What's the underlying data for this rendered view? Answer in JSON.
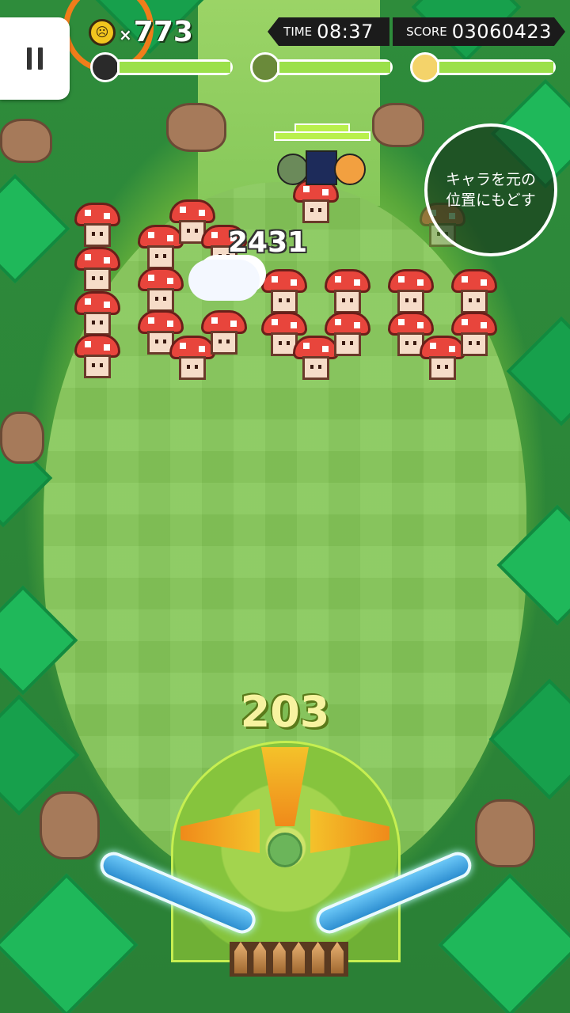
{
  "hud": {
    "coin_icon": "angry-coin-icon",
    "coin_multiplier": "×",
    "coin_count": "773",
    "time_label": "TIME",
    "time_value": "08:37",
    "score_label": "SCORE",
    "score_value": "03060423",
    "party_hp": [
      {
        "name": "dark-hair-girl",
        "color": "#2a2a2a",
        "fill_fraction": 1.0
      },
      {
        "name": "skull-warrior",
        "color": "#6a8a3a",
        "fill_fraction": 1.0
      },
      {
        "name": "blonde-girl",
        "color": "#f4d36a",
        "fill_fraction": 1.0
      }
    ]
  },
  "return_button": {
    "label_line1": "キャラを元の",
    "label_line2": "位置にもどす"
  },
  "effects": {
    "damage_number": "2431",
    "combo_counter": "203"
  },
  "colors": {
    "accent_ring": "#f07d1a",
    "hp_fill": "#9be04a",
    "flipper": "#2e8fd1",
    "mushroom_cap": "#e8453c"
  }
}
